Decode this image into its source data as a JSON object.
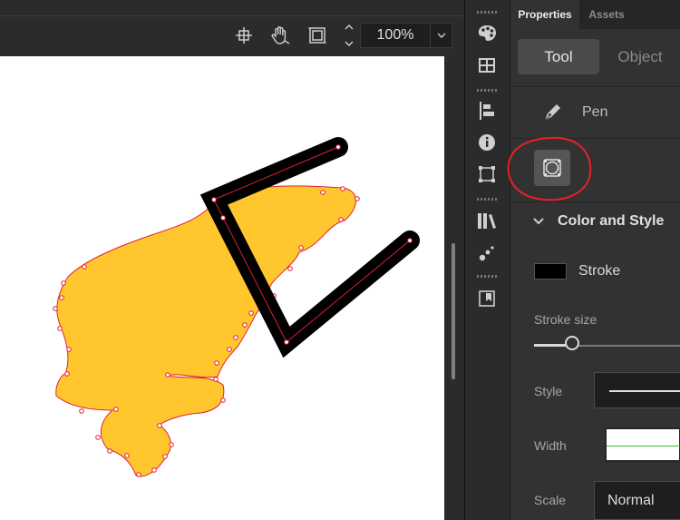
{
  "toolbar": {
    "zoom_value": "100%",
    "icons": [
      "crosshair-icon",
      "hand-icon",
      "clip-frame-icon"
    ]
  },
  "panel": {
    "tabs": [
      {
        "label": "Properties",
        "active": true
      },
      {
        "label": "Assets",
        "active": false
      }
    ],
    "segment": {
      "tool_label": "Tool",
      "object_label": "Object",
      "selected": "Tool"
    },
    "current_tool": {
      "icon": "pen-icon",
      "label": "Pen"
    },
    "option_button_icon": "object-drawing-mode-icon",
    "section": {
      "title": "Color and Style",
      "expanded": true
    },
    "stroke_label": "Stroke",
    "stroke_color": "#000000",
    "stroke_size_label": "Stroke size",
    "style_label": "Style",
    "width_label": "Width",
    "scale_label": "Scale",
    "scale_value": "Normal"
  },
  "strip_icons": [
    "color-palette-icon",
    "swatches-icon",
    "align-icon",
    "info-icon",
    "transform-icon",
    "library-icon",
    "motion-presets-icon",
    "frame-picker-icon"
  ],
  "canvas": {
    "fill_color": "#ffc62d",
    "path_color": "#e0203a",
    "stroke_color": "#000000",
    "background": "#ffffff"
  },
  "annotation": {
    "color": "#e8202a",
    "shape": "ellipse"
  }
}
